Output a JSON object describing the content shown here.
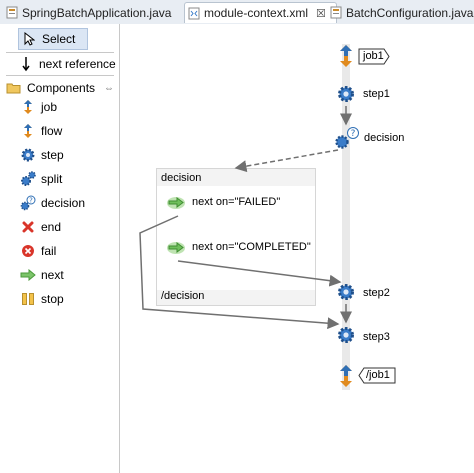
{
  "tabs": [
    {
      "label": "SpringBatchApplication.java",
      "icon": "java-file-icon",
      "active": false
    },
    {
      "label": "module-context.xml",
      "icon": "xml-file-icon",
      "active": true,
      "close": "☒"
    },
    {
      "label": "BatchConfiguration.java",
      "icon": "java-file-icon",
      "active": false
    }
  ],
  "palette": {
    "select": "Select",
    "next_reference": "next reference",
    "components_header": "Components",
    "collapse_glyph": "⇔",
    "items": [
      {
        "label": "job",
        "icon": "job-icon"
      },
      {
        "label": "flow",
        "icon": "flow-icon"
      },
      {
        "label": "step",
        "icon": "step-gear-icon"
      },
      {
        "label": "split",
        "icon": "split-icon"
      },
      {
        "label": "decision",
        "icon": "decision-icon"
      },
      {
        "label": "end",
        "icon": "end-icon"
      },
      {
        "label": "fail",
        "icon": "fail-icon"
      },
      {
        "label": "next",
        "icon": "next-arrow-icon"
      },
      {
        "label": "stop",
        "icon": "stop-icon"
      }
    ]
  },
  "canvas": {
    "job_start": "job1",
    "step1": "step1",
    "decision": "decision",
    "decision_box": {
      "title": "decision",
      "next_failed": "next on=\"FAILED\"",
      "next_completed": "next on=\"COMPLETED\"",
      "footer": "/decision"
    },
    "step2": "step2",
    "step3": "step3",
    "job_end": "/job1"
  },
  "colors": {
    "gear_blue": "#3a7cc9",
    "arrow_orange": "#e08a1e",
    "arrow_blue": "#2f6fb5",
    "connector_grey": "#707070",
    "next_green": "#5cb85c"
  }
}
